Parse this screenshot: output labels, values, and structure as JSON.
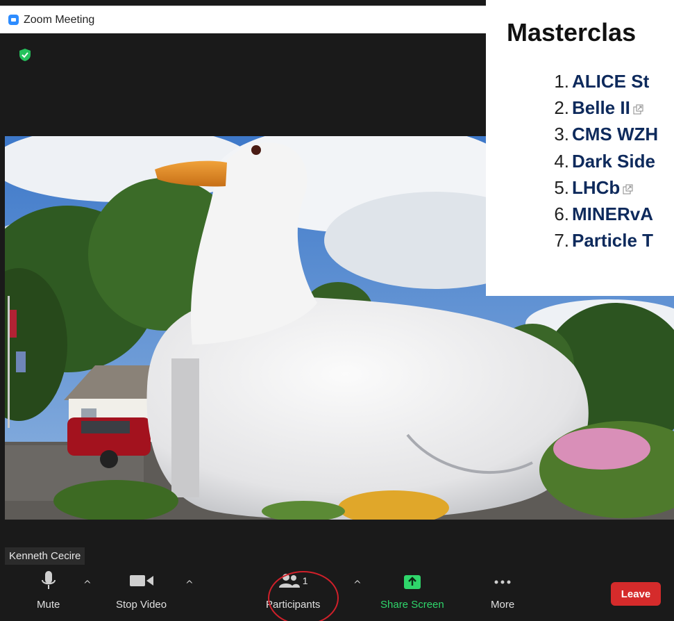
{
  "window": {
    "title": "Zoom Meeting"
  },
  "participant": {
    "name": "Kenneth Cecire"
  },
  "toolbar": {
    "mute_label": "Mute",
    "stop_video_label": "Stop Video",
    "participants_label": "Participants",
    "participants_count": "1",
    "share_screen_label": "Share Screen",
    "more_label": "More",
    "leave_label": "Leave",
    "caret": "^"
  },
  "overlay": {
    "heading": "Masterclas",
    "items": [
      {
        "num": "1.",
        "text": "ALICE St"
      },
      {
        "num": "2.",
        "text": "Belle II"
      },
      {
        "num": "3.",
        "text": "CMS WZH"
      },
      {
        "num": "4.",
        "text": "Dark Side"
      },
      {
        "num": "5.",
        "text": "LHCb"
      },
      {
        "num": "6.",
        "text": "MINERvA"
      },
      {
        "num": "7.",
        "text": "Particle T"
      }
    ]
  },
  "colors": {
    "accent": "#2d8cff",
    "share_green": "#2fd66b",
    "leave_red": "#d52b2b",
    "link_blue": "#0e2a5c",
    "annotation_red": "#d0202a"
  },
  "icons": [
    "zoom-app-icon",
    "security-shield-icon",
    "microphone-icon",
    "video-camera-icon",
    "participants-icon",
    "share-screen-icon",
    "more-dots-icon",
    "external-link-icon"
  ]
}
